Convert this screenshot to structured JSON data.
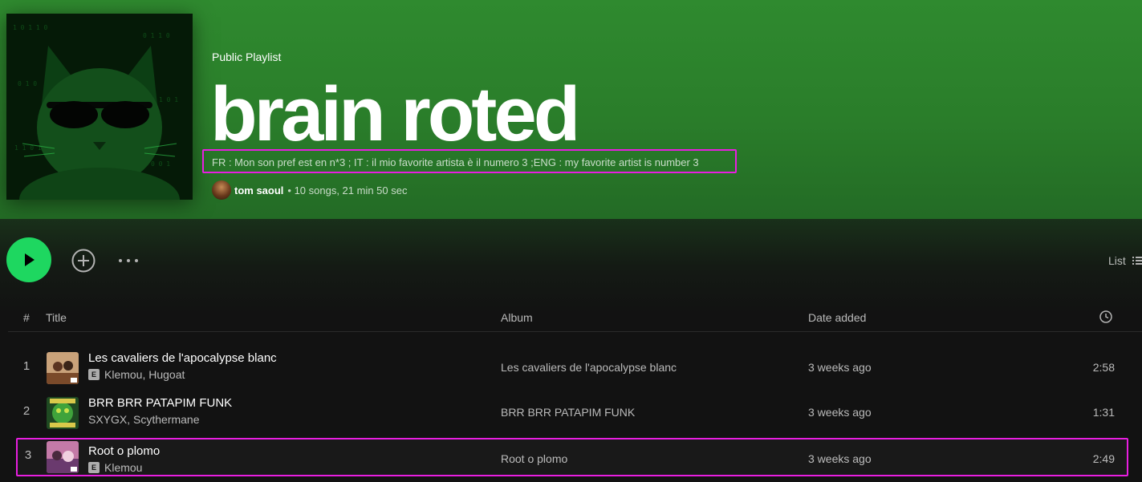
{
  "playlist": {
    "type_label": "Public Playlist",
    "title": "brain roted",
    "description": "FR : Mon son pref est en n*3 ; IT : il mio favorite artista è il numero 3 ;ENG : my favorite artist is number 3",
    "owner": "tom saoul",
    "stats": "• 10 songs, 21 min 50 sec"
  },
  "actions": {
    "play_icon": "play-icon",
    "add_icon": "plus-circle-icon",
    "more_icon": "more-dots-icon",
    "view_label": "List"
  },
  "table": {
    "headers": {
      "num": "#",
      "title": "Title",
      "album": "Album",
      "date": "Date added",
      "duration_icon": "clock-icon"
    },
    "rows": [
      {
        "num": "1",
        "title": "Les cavaliers de l'apocalypse blanc",
        "explicit": "E",
        "artists": "Klemou, Hugoat",
        "album": "Les cavaliers de l'apocalypse blanc",
        "date": "3 weeks ago",
        "duration": "2:58"
      },
      {
        "num": "2",
        "title": "BRR BRR PATAPIM FUNK",
        "explicit": "",
        "artists": "SXYGX, Scythermane",
        "album": "BRR BRR PATAPIM FUNK",
        "date": "3 weeks ago",
        "duration": "1:31"
      },
      {
        "num": "3",
        "title": "Root o plomo",
        "explicit": "E",
        "artists": "Klemou",
        "album": "Root o plomo",
        "date": "3 weeks ago",
        "duration": "2:49"
      }
    ]
  },
  "colors": {
    "accent": "#1ed760",
    "highlight": "#e81ee0",
    "hero": "#2f8a2f"
  }
}
